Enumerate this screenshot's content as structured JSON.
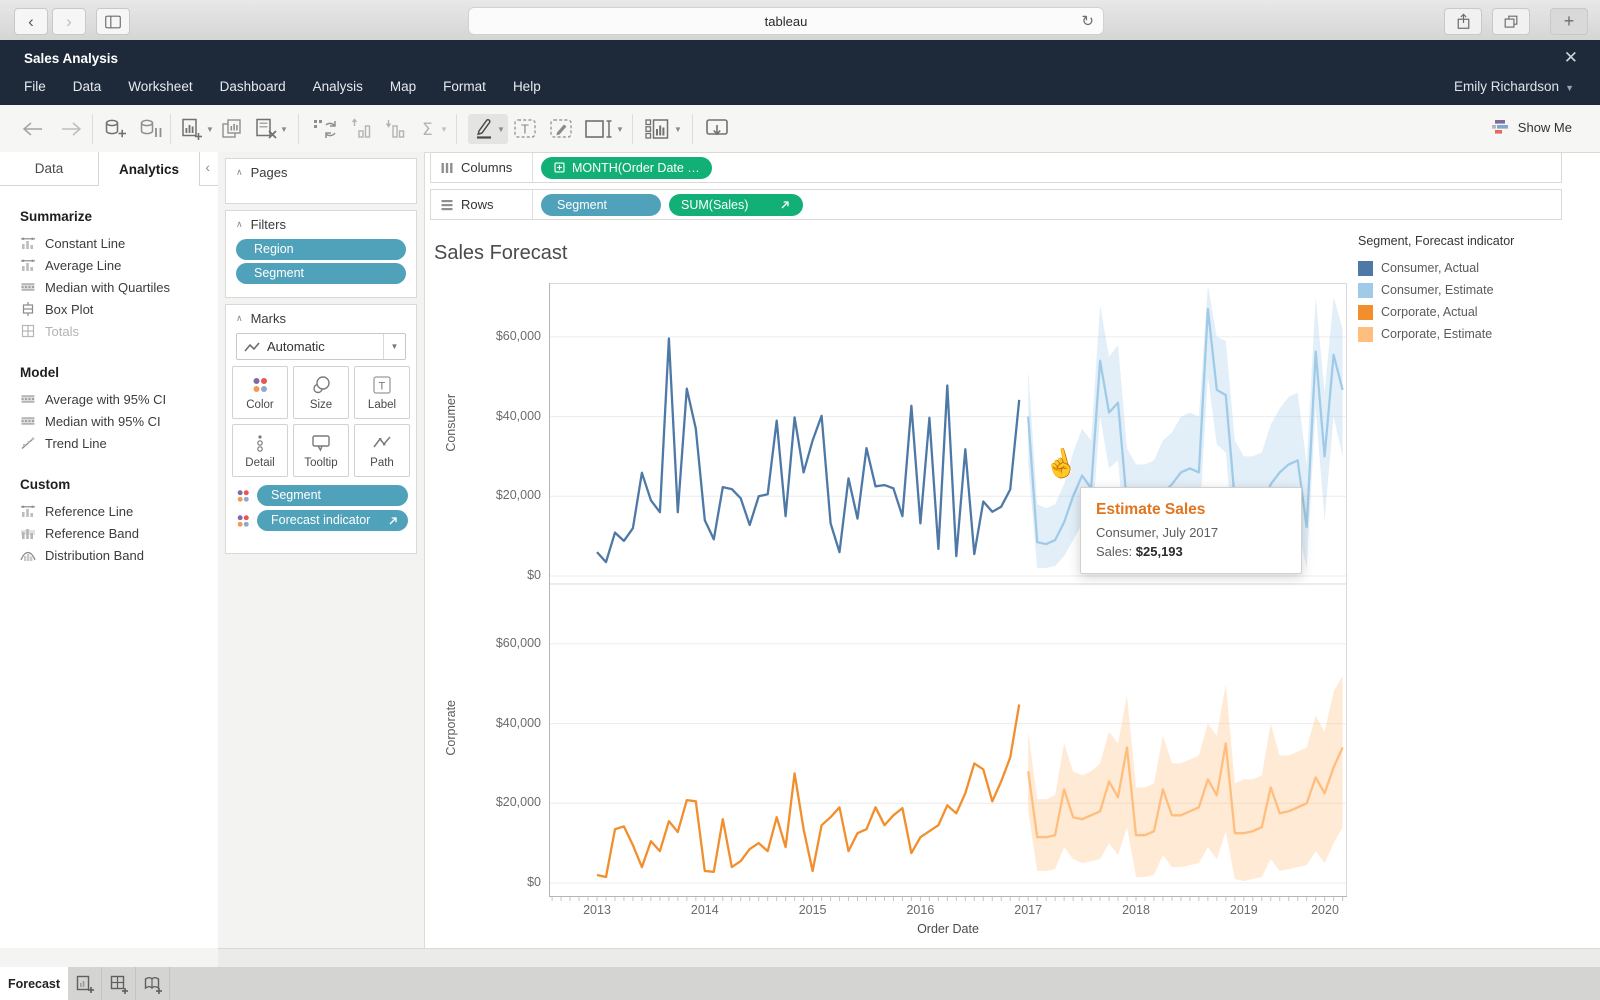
{
  "browser": {
    "page_title": "tableau"
  },
  "app": {
    "title": "Sales Analysis",
    "user": "Emily Richardson"
  },
  "menu": {
    "items": [
      "File",
      "Data",
      "Worksheet",
      "Dashboard",
      "Analysis",
      "Map",
      "Format",
      "Help"
    ]
  },
  "toolbar": {
    "show_me_label": "Show Me",
    "icons": [
      "undo",
      "redo",
      "connect-data",
      "pause-auto-updates",
      "new-worksheet",
      "duplicate-sheet",
      "clear-sheet",
      "swap-rows-columns",
      "sort-ascending",
      "sort-descending",
      "totals-sigma",
      "highlight",
      "show-mark-labels",
      "fix-axes",
      "fit-selector",
      "show-hide-cards",
      "presentation-mode"
    ]
  },
  "left_panel": {
    "tabs": [
      "Data",
      "Analytics"
    ],
    "active_tab": "Analytics",
    "sections": [
      {
        "title": "Summarize",
        "items": [
          "Constant Line",
          "Average Line",
          "Median with Quartiles",
          "Box Plot",
          "Totals"
        ]
      },
      {
        "title": "Model",
        "items": [
          "Average with 95% CI",
          "Median with 95% CI",
          "Trend Line"
        ]
      },
      {
        "title": "Custom",
        "items": [
          "Reference Line",
          "Reference Band",
          "Distribution Band"
        ]
      }
    ],
    "disabled_items": [
      "Totals"
    ]
  },
  "cards": {
    "pages_title": "Pages",
    "filters_title": "Filters",
    "filter_pills": [
      "Region",
      "Segment"
    ],
    "marks_title": "Marks",
    "marks_dropdown_label": "Automatic",
    "mark_buttons": [
      "Color",
      "Size",
      "Label",
      "Detail",
      "Tooltip",
      "Path"
    ],
    "mark_pills": [
      {
        "label": "Segment"
      },
      {
        "label": "Forecast indicator",
        "has_forecast_icon": true
      }
    ]
  },
  "shelves": {
    "columns_label": "Columns",
    "rows_label": "Rows",
    "columns_pills": [
      {
        "label": "MONTH(Order Date …",
        "type": "green",
        "has_plus_icon": true
      }
    ],
    "rows_pills": [
      {
        "label": "Segment",
        "type": "blue"
      },
      {
        "label": "SUM(Sales)",
        "type": "green",
        "has_forecast_icon": true
      }
    ]
  },
  "viz": {
    "title": "Sales Forecast"
  },
  "legend": {
    "title": "Segment, Forecast indicator",
    "items": [
      {
        "label": "Consumer, Actual",
        "color": "#4e79a7"
      },
      {
        "label": "Consumer, Estimate",
        "color": "#a0cbe8"
      },
      {
        "label": "Corporate, Actual",
        "color": "#f28e2b"
      },
      {
        "label": "Corporate, Estimate",
        "color": "#ffbe7d"
      }
    ]
  },
  "tooltip": {
    "title": "Estimate Sales",
    "subtitle": "Consumer, July 2017",
    "value_label": "Sales:",
    "value": "$25,193"
  },
  "sheet_tabs": {
    "active": "Forecast"
  },
  "chart_data": {
    "type": "line",
    "title": "Sales Forecast",
    "xlabel": "Order Date",
    "x_tick_labels": [
      "2013",
      "2014",
      "2015",
      "2016",
      "2017",
      "2018",
      "2019",
      "2020"
    ],
    "x_start": "2013-01",
    "x_unit": "month",
    "ylim": [
      0,
      73000
    ],
    "y_ticks": [
      0,
      20000,
      40000,
      60000
    ],
    "y_tick_labels": [
      "$0",
      "$20,000",
      "$40,000",
      "$60,000"
    ],
    "grid": true,
    "legend_position": "top-right",
    "forecast_note": "Estimate begins 2017-01; July 2017 Consumer estimate = $25,193",
    "panes": [
      {
        "label": "Consumer",
        "actual": {
          "name": "Consumer, Actual",
          "color": "#4e79a7",
          "start_month": 0,
          "values": [
            6000,
            3500,
            10900,
            8800,
            12000,
            25900,
            19000,
            16000,
            59600,
            16000,
            47000,
            37000,
            14000,
            9200,
            22300,
            21800,
            19500,
            12800,
            20000,
            20500,
            39000,
            15000,
            39800,
            26000,
            34000,
            40200,
            13200,
            6000,
            24500,
            14400,
            32100,
            22500,
            22800,
            22000,
            15000,
            42700,
            13200,
            39700,
            6800,
            47800,
            5000,
            31800,
            5500,
            18700,
            16100,
            17400,
            21700,
            44200
          ]
        },
        "estimate": {
          "name": "Consumer, Estimate",
          "color": "#a0cbe8",
          "start_month": 48,
          "values": [
            40000,
            8500,
            8000,
            9000,
            13500,
            20000,
            25193,
            22000,
            54000,
            41000,
            43500,
            18000,
            15000,
            15500,
            16500,
            21000,
            23000,
            26000,
            27000,
            26000,
            67000,
            46700,
            45400,
            19000,
            16000,
            16500,
            17500,
            23000,
            26000,
            28000,
            29000,
            12300,
            56300,
            30000,
            55500,
            46700
          ]
        },
        "band": {
          "name": "Consumer, Estimate 95% interval",
          "color": "#a0cbe8",
          "opacity": 0.3,
          "start_month": 48,
          "lo": [
            28000,
            2000,
            2000,
            2500,
            5000,
            9000,
            13000,
            10000,
            40000,
            27000,
            29000,
            5000,
            3000,
            3500,
            4000,
            8000,
            10000,
            12000,
            13000,
            12000,
            50000,
            33000,
            31000,
            5000,
            2000,
            2500,
            3000,
            7000,
            9000,
            11000,
            12000,
            2000,
            42000,
            14000,
            40000,
            30000
          ],
          "hi": [
            52000,
            18000,
            17000,
            18000,
            23000,
            31000,
            37000,
            34000,
            68000,
            55000,
            58000,
            32000,
            28000,
            28000,
            29000,
            34000,
            36000,
            40000,
            41000,
            40000,
            73000,
            60000,
            59000,
            34000,
            30000,
            30000,
            31000,
            38000,
            42000,
            45000,
            46000,
            28000,
            70000,
            46000,
            70000,
            62000
          ]
        }
      },
      {
        "label": "Corporate",
        "actual": {
          "name": "Corporate, Actual",
          "color": "#f28e2b",
          "start_month": 0,
          "values": [
            2000,
            1500,
            13500,
            14200,
            9500,
            4000,
            10500,
            8000,
            15500,
            12800,
            20800,
            20500,
            3000,
            2800,
            16000,
            4000,
            5500,
            8500,
            10000,
            8000,
            16500,
            9000,
            27500,
            13500,
            3000,
            14500,
            16500,
            19000,
            8000,
            12500,
            13500,
            19000,
            14500,
            17000,
            18800,
            7500,
            11500,
            13000,
            14500,
            19500,
            17500,
            22500,
            30000,
            28500,
            20500,
            25500,
            31500,
            44800
          ]
        },
        "estimate": {
          "name": "Corporate, Estimate",
          "color": "#ffbe7d",
          "start_month": 48,
          "values": [
            28000,
            11500,
            11500,
            12000,
            23500,
            16500,
            16000,
            17000,
            18000,
            25500,
            21500,
            34000,
            12000,
            12000,
            13000,
            23500,
            17000,
            17000,
            18000,
            19000,
            26000,
            22000,
            35000,
            12500,
            12500,
            13000,
            14000,
            24000,
            17500,
            18000,
            19000,
            20000,
            26500,
            22500,
            29000,
            34000
          ]
        },
        "band": {
          "name": "Corporate, Estimate 95% interval",
          "color": "#ffbe7d",
          "opacity": 0.32,
          "start_month": 48,
          "lo": [
            18000,
            3000,
            3000,
            3500,
            9000,
            6000,
            5000,
            5500,
            6000,
            10000,
            7000,
            14000,
            1500,
            1500,
            2000,
            7000,
            4000,
            4000,
            4500,
            5000,
            9000,
            6000,
            13000,
            1000,
            500,
            1000,
            1500,
            6000,
            3000,
            3500,
            4000,
            4500,
            8000,
            5000,
            10000,
            14000
          ],
          "hi": [
            38000,
            21000,
            21000,
            22000,
            35000,
            28000,
            27000,
            28000,
            30000,
            38000,
            35000,
            47000,
            24000,
            24000,
            25000,
            37000,
            30000,
            30000,
            31000,
            32000,
            40000,
            37000,
            50000,
            25000,
            26000,
            26000,
            27000,
            40000,
            32000,
            32000,
            33000,
            34000,
            42000,
            38000,
            48000,
            52000
          ]
        }
      }
    ]
  }
}
